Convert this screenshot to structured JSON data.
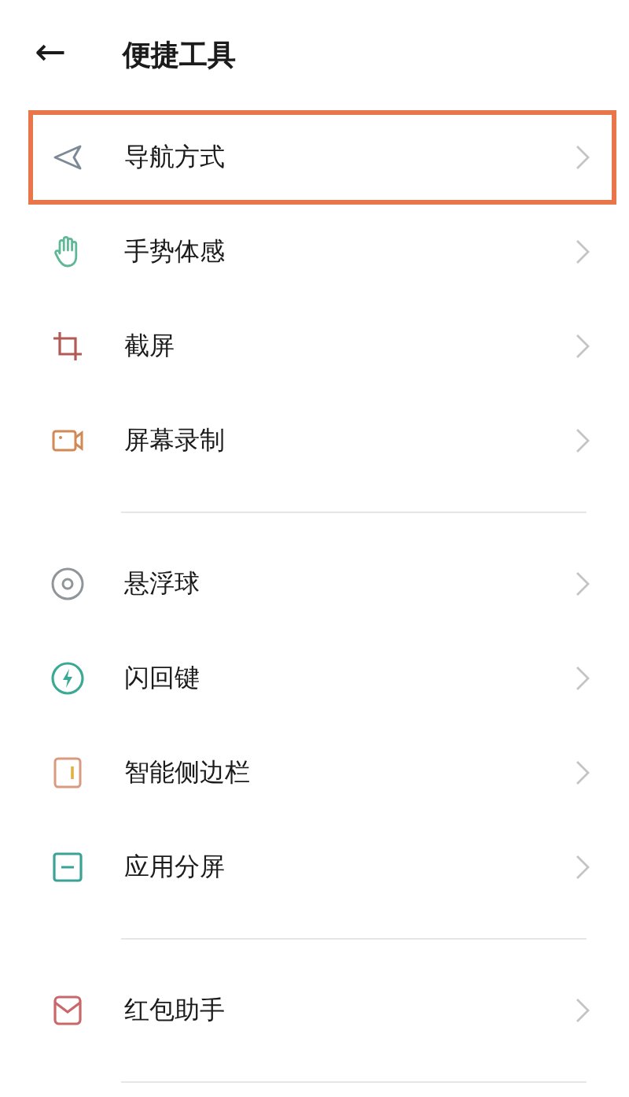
{
  "header": {
    "back_icon": "←",
    "title": "便捷工具"
  },
  "sections": [
    {
      "items": [
        {
          "kind": "navigation",
          "label": "导航方式",
          "highlighted": true
        },
        {
          "kind": "gesture",
          "label": "手势体感",
          "highlighted": false
        },
        {
          "kind": "screenshot",
          "label": "截屏",
          "highlighted": false
        },
        {
          "kind": "record",
          "label": "屏幕录制",
          "highlighted": false
        }
      ]
    },
    {
      "items": [
        {
          "kind": "ball",
          "label": "悬浮球",
          "highlighted": false
        },
        {
          "kind": "flash",
          "label": "闪回键",
          "highlighted": false
        },
        {
          "kind": "sidebar",
          "label": "智能侧边栏",
          "highlighted": false
        },
        {
          "kind": "split",
          "label": "应用分屏",
          "highlighted": false
        }
      ]
    },
    {
      "items": [
        {
          "kind": "envelope",
          "label": "红包助手",
          "highlighted": false
        }
      ]
    }
  ]
}
